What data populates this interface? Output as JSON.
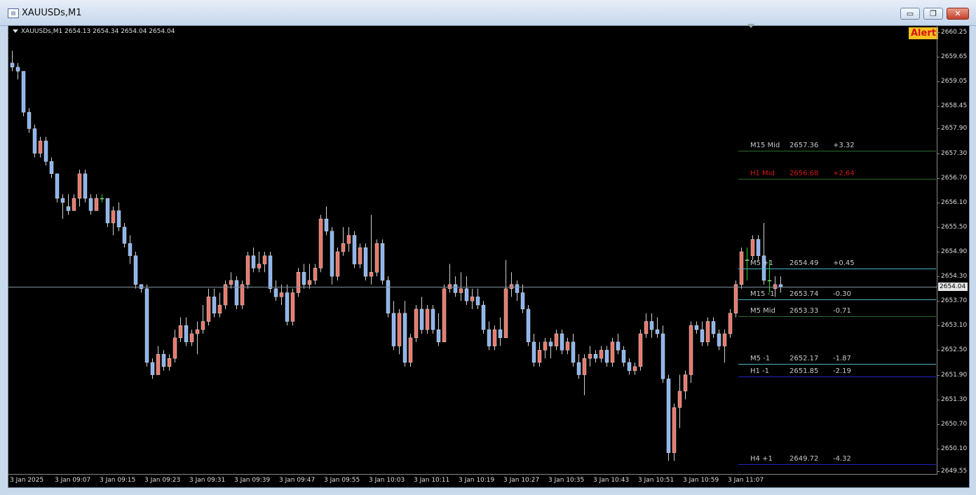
{
  "window": {
    "title": "XAUUSDs,M1",
    "minimize": "▭",
    "restore": "❐",
    "close": "✕"
  },
  "chart": {
    "info": "XAUUSDs,M1  2654.13 2654.34 2654.04 2654.04",
    "alert": "Alert",
    "current_price": "2654.04",
    "current_value": 2654.04,
    "price_labels": [
      "2660.25",
      "2659.65",
      "2659.05",
      "2658.45",
      "2657.90",
      "2657.30",
      "2656.70",
      "2656.10",
      "2655.50",
      "2654.90",
      "2654.30",
      "2653.70",
      "2653.10",
      "2652.50",
      "2651.90",
      "2651.30",
      "2650.70",
      "2650.10",
      "2649.55"
    ],
    "time_labels": [
      "3 Jan 2025",
      "3 Jan 09:07",
      "3 Jan 09:15",
      "3 Jan 09:23",
      "3 Jan 09:31",
      "3 Jan 09:39",
      "3 Jan 09:47",
      "3 Jan 09:55",
      "3 Jan 10:03",
      "3 Jan 10:11",
      "3 Jan 10:19",
      "3 Jan 10:27",
      "3 Jan 10:35",
      "3 Jan 10:43",
      "3 Jan 10:51",
      "3 Jan 10:59",
      "3 Jan 11:07"
    ],
    "colors": {
      "bull": "#e8796b",
      "bear": "#8cb4ee",
      "doji": "#22d422",
      "wick": "#cfcfcf"
    },
    "levels": [
      {
        "name": "M15 Mid",
        "price": "2657.36",
        "diff": "+3.32",
        "value": 2657.36,
        "text_color": "#c8c8c8",
        "line_color": "#2e6a2e"
      },
      {
        "name": "H1 Mid",
        "price": "2656.68",
        "diff": "+2.64",
        "value": 2656.68,
        "text_color": "#d01818",
        "line_color": "#2e6a2e"
      },
      {
        "name": "M5 +1",
        "price": "2654.49",
        "diff": "+0.45",
        "value": 2654.49,
        "text_color": "#c8c8c8",
        "line_color": "#4fb0c4"
      },
      {
        "name": "M15 -1",
        "price": "2653.74",
        "diff": "-0.30",
        "value": 2653.74,
        "text_color": "#c8c8c8",
        "line_color": "#4fb0c4"
      },
      {
        "name": "M5 Mid",
        "price": "2653.33",
        "diff": "-0.71",
        "value": 2653.33,
        "text_color": "#c8c8c8",
        "line_color": "#2e6a2e"
      },
      {
        "name": "M5 -1",
        "price": "2652.17",
        "diff": "-1.87",
        "value": 2652.17,
        "text_color": "#c8c8c8",
        "line_color": "#4fb0c4"
      },
      {
        "name": "H1 -1",
        "price": "2651.85",
        "diff": "-2.19",
        "value": 2651.85,
        "text_color": "#c8c8c8",
        "line_color": "#2424c8"
      },
      {
        "name": "H4 +1",
        "price": "2649.72",
        "diff": "-4.32",
        "value": 2649.72,
        "text_color": "#c8c8c8",
        "line_color": "#2424c8"
      }
    ]
  },
  "chart_data": {
    "type": "candlestick",
    "y_range": [
      2649.55,
      2660.25
    ],
    "candles": [
      [
        2659.5,
        2659.8,
        2659.3,
        2659.4
      ],
      [
        2659.4,
        2659.5,
        2659.1,
        2659.3
      ],
      [
        2659.3,
        2659.3,
        2658.2,
        2658.3
      ],
      [
        2658.3,
        2658.4,
        2657.8,
        2657.9
      ],
      [
        2657.9,
        2658.0,
        2657.2,
        2657.3
      ],
      [
        2657.3,
        2657.7,
        2657.2,
        2657.6
      ],
      [
        2657.6,
        2657.7,
        2657.0,
        2657.1
      ],
      [
        2657.1,
        2657.2,
        2656.7,
        2656.8
      ],
      [
        2656.8,
        2656.8,
        2656.1,
        2656.2
      ],
      [
        2656.2,
        2656.3,
        2655.7,
        2656.1
      ],
      [
        2656.0,
        2656.3,
        2655.8,
        2655.9
      ],
      [
        2655.9,
        2656.3,
        2655.9,
        2656.2
      ],
      [
        2656.2,
        2656.9,
        2656.0,
        2656.8
      ],
      [
        2656.8,
        2656.9,
        2656.1,
        2656.2
      ],
      [
        2656.2,
        2656.3,
        2655.8,
        2655.9
      ],
      [
        2655.9,
        2656.3,
        2655.9,
        2656.2
      ],
      [
        2656.2,
        2656.3,
        2656.1,
        2656.2
      ],
      [
        2656.2,
        2656.2,
        2655.5,
        2655.6
      ],
      [
        2655.6,
        2656.0,
        2655.3,
        2655.9
      ],
      [
        2655.9,
        2656.1,
        2655.4,
        2655.5
      ],
      [
        2655.5,
        2655.6,
        2655.0,
        2655.1
      ],
      [
        2655.1,
        2655.3,
        2654.6,
        2654.8
      ],
      [
        2654.8,
        2654.9,
        2654.0,
        2654.1
      ],
      [
        2654.1,
        2654.1,
        2653.9,
        2654.0
      ],
      [
        2654.0,
        2654.1,
        2652.1,
        2652.2
      ],
      [
        2652.2,
        2652.3,
        2651.8,
        2651.9
      ],
      [
        2651.9,
        2652.6,
        2651.9,
        2652.4
      ],
      [
        2652.4,
        2652.5,
        2652.0,
        2652.1
      ],
      [
        2652.1,
        2652.4,
        2652.0,
        2652.3
      ],
      [
        2652.3,
        2653.0,
        2652.2,
        2652.8
      ],
      [
        2652.8,
        2653.3,
        2652.7,
        2653.1
      ],
      [
        2653.1,
        2653.3,
        2652.6,
        2652.7
      ],
      [
        2652.7,
        2653.0,
        2652.6,
        2652.9
      ],
      [
        2652.9,
        2653.2,
        2652.4,
        2653.0
      ],
      [
        2653.0,
        2653.6,
        2652.9,
        2653.2
      ],
      [
        2653.2,
        2654.0,
        2653.1,
        2653.8
      ],
      [
        2653.8,
        2654.0,
        2653.3,
        2653.4
      ],
      [
        2653.4,
        2653.9,
        2653.3,
        2653.6
      ],
      [
        2653.6,
        2654.2,
        2653.5,
        2654.1
      ],
      [
        2654.1,
        2654.4,
        2654.0,
        2654.2
      ],
      [
        2654.2,
        2654.3,
        2653.5,
        2653.6
      ],
      [
        2653.6,
        2654.2,
        2653.5,
        2654.1
      ],
      [
        2654.1,
        2654.9,
        2654.0,
        2654.8
      ],
      [
        2654.8,
        2655.0,
        2654.4,
        2654.5
      ],
      [
        2654.5,
        2654.9,
        2654.4,
        2654.6
      ],
      [
        2654.6,
        2654.9,
        2654.4,
        2654.8
      ],
      [
        2654.8,
        2654.9,
        2653.9,
        2654.0
      ],
      [
        2654.0,
        2654.2,
        2653.7,
        2653.8
      ],
      [
        2653.8,
        2654.1,
        2653.6,
        2653.9
      ],
      [
        2653.9,
        2654.1,
        2653.1,
        2653.2
      ],
      [
        2653.2,
        2654.0,
        2653.1,
        2653.9
      ],
      [
        2653.9,
        2654.5,
        2653.8,
        2654.4
      ],
      [
        2654.4,
        2654.6,
        2654.0,
        2654.1
      ],
      [
        2654.1,
        2654.6,
        2654.0,
        2654.2
      ],
      [
        2654.2,
        2654.6,
        2654.1,
        2654.5
      ],
      [
        2654.5,
        2655.8,
        2654.4,
        2655.7
      ],
      [
        2655.7,
        2656.0,
        2655.3,
        2655.4
      ],
      [
        2655.4,
        2655.5,
        2654.1,
        2654.3
      ],
      [
        2654.3,
        2655.0,
        2654.2,
        2654.9
      ],
      [
        2654.9,
        2655.5,
        2654.8,
        2655.1
      ],
      [
        2655.1,
        2655.5,
        2654.9,
        2655.3
      ],
      [
        2655.3,
        2655.4,
        2654.5,
        2654.6
      ],
      [
        2654.6,
        2655.1,
        2654.5,
        2655.0
      ],
      [
        2655.0,
        2655.1,
        2654.2,
        2654.3
      ],
      [
        2654.3,
        2655.8,
        2654.1,
        2654.4
      ],
      [
        2654.4,
        2655.2,
        2654.3,
        2655.1
      ],
      [
        2655.1,
        2655.2,
        2654.1,
        2654.2
      ],
      [
        2654.2,
        2654.3,
        2653.3,
        2653.4
      ],
      [
        2653.4,
        2653.7,
        2652.5,
        2652.6
      ],
      [
        2652.6,
        2653.5,
        2652.4,
        2653.4
      ],
      [
        2653.4,
        2653.7,
        2652.1,
        2652.2
      ],
      [
        2652.2,
        2652.9,
        2652.1,
        2652.8
      ],
      [
        2652.8,
        2653.6,
        2652.7,
        2653.5
      ],
      [
        2653.5,
        2653.8,
        2652.9,
        2653.0
      ],
      [
        2653.0,
        2653.6,
        2652.9,
        2653.5
      ],
      [
        2653.5,
        2653.6,
        2652.9,
        2653.0
      ],
      [
        2653.0,
        2653.4,
        2652.6,
        2652.7
      ],
      [
        2652.7,
        2654.1,
        2652.7,
        2654.0
      ],
      [
        2654.0,
        2654.6,
        2653.9,
        2654.1
      ],
      [
        2654.1,
        2654.3,
        2653.8,
        2653.9
      ],
      [
        2653.9,
        2654.4,
        2653.7,
        2654.0
      ],
      [
        2654.0,
        2654.3,
        2653.6,
        2653.7
      ],
      [
        2653.7,
        2654.0,
        2653.5,
        2653.8
      ],
      [
        2653.8,
        2654.0,
        2653.5,
        2653.6
      ],
      [
        2653.6,
        2653.7,
        2652.9,
        2653.0
      ],
      [
        2653.0,
        2653.2,
        2652.5,
        2652.6
      ],
      [
        2652.6,
        2653.1,
        2652.5,
        2653.0
      ],
      [
        2653.0,
        2653.3,
        2652.6,
        2652.8
      ],
      [
        2652.8,
        2654.7,
        2652.8,
        2654.0
      ],
      [
        2654.0,
        2654.4,
        2653.8,
        2654.1
      ],
      [
        2654.1,
        2654.2,
        2653.7,
        2653.9
      ],
      [
        2653.9,
        2654.1,
        2653.4,
        2653.5
      ],
      [
        2653.5,
        2653.6,
        2652.6,
        2652.7
      ],
      [
        2652.7,
        2652.9,
        2652.1,
        2652.2
      ],
      [
        2652.2,
        2652.7,
        2652.1,
        2652.5
      ],
      [
        2652.5,
        2652.8,
        2652.3,
        2652.7
      ],
      [
        2652.7,
        2652.8,
        2652.3,
        2652.6
      ],
      [
        2652.6,
        2653.0,
        2652.5,
        2652.9
      ],
      [
        2652.9,
        2653.0,
        2652.4,
        2652.5
      ],
      [
        2652.5,
        2652.8,
        2652.4,
        2652.7
      ],
      [
        2652.7,
        2652.9,
        2652.1,
        2652.2
      ],
      [
        2652.2,
        2652.4,
        2651.8,
        2651.9
      ],
      [
        2651.9,
        2652.4,
        2651.4,
        2652.3
      ],
      [
        2652.3,
        2652.6,
        2652.1,
        2652.4
      ],
      [
        2652.4,
        2652.5,
        2652.2,
        2652.3
      ],
      [
        2652.3,
        2652.6,
        2652.2,
        2652.5
      ],
      [
        2652.5,
        2652.6,
        2652.1,
        2652.2
      ],
      [
        2652.2,
        2652.8,
        2652.1,
        2652.7
      ],
      [
        2652.7,
        2652.9,
        2652.4,
        2652.5
      ],
      [
        2652.5,
        2652.6,
        2652.1,
        2652.2
      ],
      [
        2652.2,
        2652.3,
        2651.9,
        2652.0
      ],
      [
        2652.0,
        2652.2,
        2651.9,
        2652.1
      ],
      [
        2652.1,
        2653.0,
        2652.0,
        2652.9
      ],
      [
        2652.9,
        2653.4,
        2652.8,
        2653.2
      ],
      [
        2653.2,
        2653.4,
        2652.8,
        2653.0
      ],
      [
        2653.0,
        2653.3,
        2652.8,
        2652.9
      ],
      [
        2652.9,
        2653.1,
        2651.7,
        2651.8
      ],
      [
        2651.8,
        2651.9,
        2649.8,
        2650.0
      ],
      [
        2650.0,
        2651.2,
        2649.8,
        2651.1
      ],
      [
        2651.1,
        2651.9,
        2650.6,
        2651.5
      ],
      [
        2651.5,
        2652.0,
        2651.3,
        2651.9
      ],
      [
        2651.9,
        2653.2,
        2651.7,
        2653.1
      ],
      [
        2653.1,
        2653.2,
        2652.9,
        2653.0
      ],
      [
        2653.0,
        2653.2,
        2652.6,
        2652.7
      ],
      [
        2652.7,
        2653.3,
        2652.6,
        2653.2
      ],
      [
        2653.2,
        2653.3,
        2652.8,
        2652.9
      ],
      [
        2652.9,
        2653.0,
        2652.5,
        2652.6
      ],
      [
        2652.6,
        2653.0,
        2652.2,
        2652.9
      ],
      [
        2652.9,
        2653.5,
        2652.8,
        2653.4
      ],
      [
        2653.4,
        2654.2,
        2653.3,
        2654.1
      ],
      [
        2654.1,
        2655.0,
        2654.0,
        2654.9
      ],
      [
        2654.7,
        2655.0,
        2654.2,
        2654.7
      ],
      [
        2654.8,
        2655.3,
        2654.7,
        2655.2
      ],
      [
        2655.2,
        2655.3,
        2654.7,
        2654.8
      ],
      [
        2654.8,
        2655.6,
        2654.1,
        2654.2
      ],
      [
        2654.2,
        2654.7,
        2653.9,
        2654.2
      ],
      [
        2654.0,
        2654.3,
        2653.8,
        2654.1
      ],
      [
        2654.1,
        2654.3,
        2653.9,
        2654.04
      ]
    ]
  }
}
